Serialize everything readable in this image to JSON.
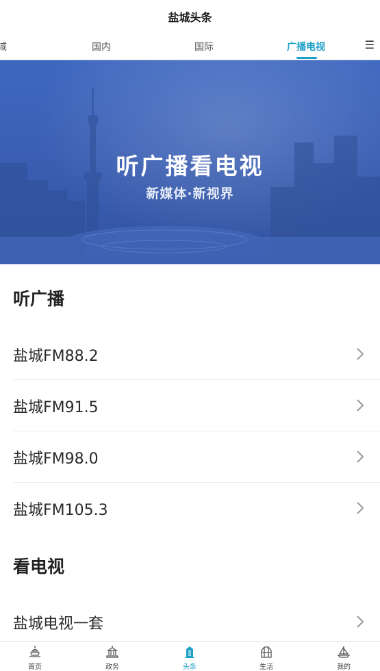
{
  "header": {
    "title": "盐城头条"
  },
  "tabs": {
    "items": [
      {
        "label": "域"
      },
      {
        "label": "国内"
      },
      {
        "label": "国际"
      },
      {
        "label": "广播电视"
      }
    ],
    "active_index": 3,
    "menu_icon": "menu-icon"
  },
  "banner": {
    "headline": "听广播看电视",
    "subline": "新媒体·新视界"
  },
  "radio": {
    "title": "听广播",
    "items": [
      {
        "label": "盐城FM88.2"
      },
      {
        "label": "盐城FM91.5"
      },
      {
        "label": "盐城FM98.0"
      },
      {
        "label": "盐城FM105.3"
      }
    ]
  },
  "tv": {
    "title": "看电视",
    "items": [
      {
        "label": "盐城电视一套"
      }
    ]
  },
  "bottom_nav": {
    "items": [
      {
        "label": "首页",
        "icon": "home-icon"
      },
      {
        "label": "政务",
        "icon": "government-icon"
      },
      {
        "label": "头条",
        "icon": "headlines-icon"
      },
      {
        "label": "生活",
        "icon": "life-icon"
      },
      {
        "label": "我的",
        "icon": "profile-icon"
      }
    ],
    "active_index": 2
  },
  "colors": {
    "accent": "#1ea0c8",
    "banner": "#3a5fb4"
  }
}
